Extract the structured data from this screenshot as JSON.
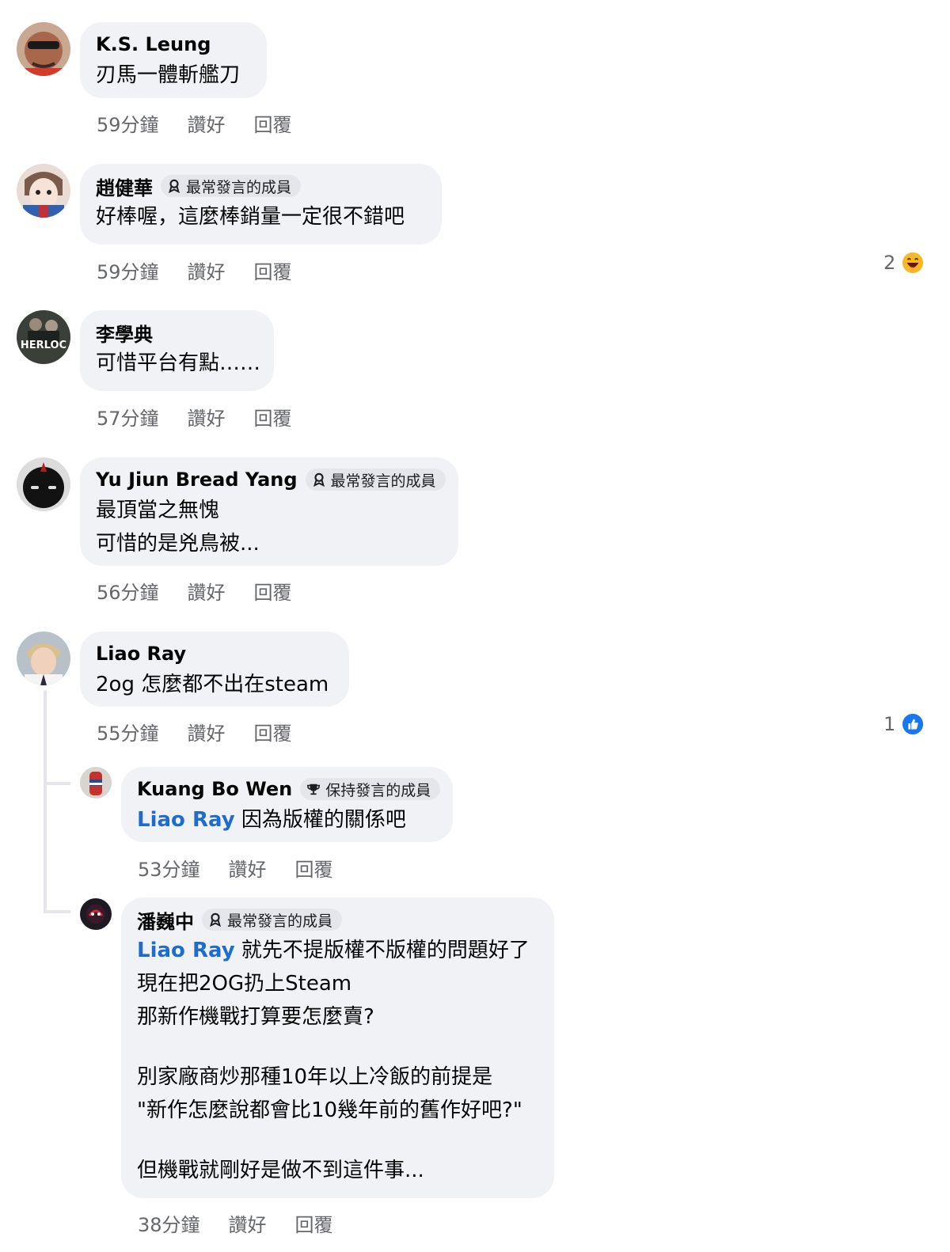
{
  "comments": [
    {
      "name": "K.S. Leung",
      "badge": "",
      "lines": [
        "刃馬一體斬艦刀"
      ],
      "time": "59分鐘",
      "like": "讚好",
      "reply": "回覆"
    },
    {
      "name": "趙健華",
      "badge": "最常發言的成員",
      "lines": [
        "好棒喔，這麼棒銷量一定很不錯吧"
      ],
      "time": "59分鐘",
      "like": "讚好",
      "reply": "回覆",
      "reaction_count": "2",
      "reaction_icon": "laughing-emoji-icon"
    },
    {
      "name": "李學典",
      "badge": "",
      "avatar_text": "HERLOC",
      "lines": [
        "可惜平台有點……"
      ],
      "time": "57分鐘",
      "like": "讚好",
      "reply": "回覆"
    },
    {
      "name": "Yu Jiun Bread Yang",
      "badge": "最常發言的成員",
      "lines": [
        "最頂當之無愧",
        "可惜的是兇鳥被..."
      ],
      "time": "56分鐘",
      "like": "讚好",
      "reply": "回覆"
    },
    {
      "name": "Liao Ray",
      "badge": "",
      "lines": [
        "2og 怎麼都不出在steam"
      ],
      "time": "55分鐘",
      "like": "讚好",
      "reply": "回覆",
      "reaction_count": "1",
      "reaction_icon": "thumbs-up-icon"
    }
  ],
  "replies": [
    {
      "name": "Kuang Bo Wen",
      "badge": "保持發言的成員",
      "mention": "Liao Ray",
      "lines": [
        "因為版權的關係吧"
      ],
      "time": "53分鐘",
      "like": "讚好",
      "reply": "回覆"
    },
    {
      "name": "潘巍中",
      "badge": "最常發言的成員",
      "mention": "Liao Ray",
      "lines": [
        "就先不提版權不版權的問題好了",
        "現在把2OG扔上Steam",
        "那新作機戰打算要怎麼賣?",
        "",
        "別家廠商炒那種10年以上冷飯的前提是",
        "\"新作怎麼說都會比10幾年前的舊作好吧?\"",
        "",
        "但機戰就剛好是做不到這件事..."
      ],
      "time": "38分鐘",
      "like": "讚好",
      "reply": "回覆"
    }
  ],
  "colors": {
    "bubble": "#f0f2f5",
    "meta_text": "#65676b",
    "mention": "#1f6ccf",
    "like_blue": "#1877f2"
  }
}
